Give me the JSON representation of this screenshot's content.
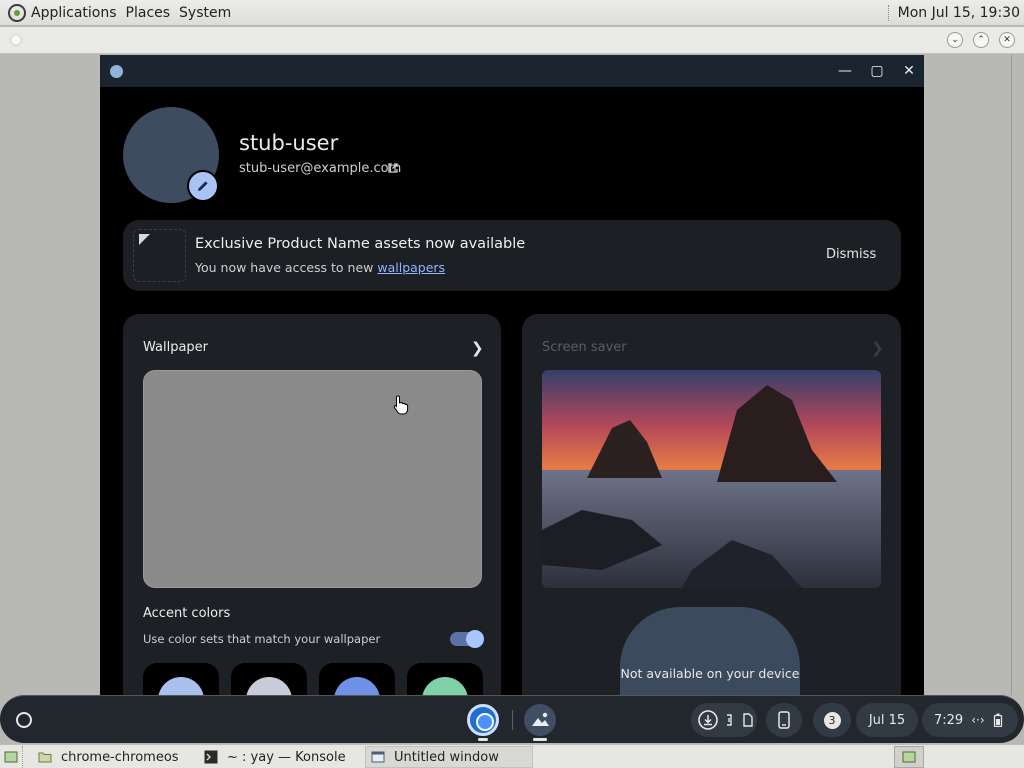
{
  "top_panel": {
    "menus": [
      "Applications",
      "Places",
      "System"
    ],
    "clock": "Mon Jul 15, 19:30"
  },
  "window": {
    "controls": {
      "minimize": "—",
      "maximize": "▢",
      "close": "✕"
    }
  },
  "profile": {
    "name": "stub-user",
    "email": "stub-user@example.com"
  },
  "banner": {
    "title": "Exclusive Product Name assets now available",
    "subtitle_prefix": "You now have access to new ",
    "subtitle_link": "wallpapers",
    "dismiss": "Dismiss"
  },
  "wallpaper_card": {
    "title": "Wallpaper",
    "accent_title": "Accent colors",
    "accent_subtitle": "Use color sets that match your wallpaper",
    "toggle_on": true,
    "swatches": [
      "#a9c0ee",
      "#c6cdd8",
      "#6e93e6",
      "#7fd1a7"
    ]
  },
  "screensaver_card": {
    "title": "Screen saver",
    "unavailable": "Not available on your device"
  },
  "shelf": {
    "notification_count": "3",
    "date": "Jul 15",
    "time": "7:29"
  },
  "taskbar": {
    "tasks": [
      "chrome-chromeos",
      "~ : yay — Konsole",
      "Untitled window"
    ]
  },
  "colors": {
    "accent": "#a8c4f5",
    "link": "#8fb6ff"
  }
}
